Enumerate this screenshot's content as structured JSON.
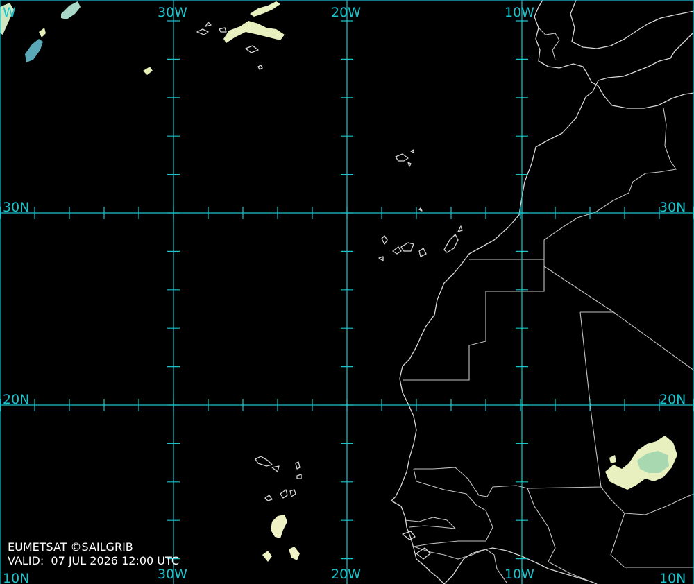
{
  "map": {
    "longitude_labels": [
      "30W",
      "20W",
      "10W"
    ],
    "latitude_labels": [
      "30N",
      "20N",
      "10N"
    ],
    "corner_label_top_left": "W",
    "corner_label_bottom_left": "10N",
    "features": [
      "coastline",
      "country-borders",
      "lat-lon-grid",
      "cloud-imagery"
    ]
  },
  "colors": {
    "background": "#000000",
    "grid": "#19c4cc",
    "coastline": "#d8d8d8",
    "cloud_light": "#e8f0c0",
    "cloud_mid": "#a8d8b0",
    "cloud_cool": "#5aa8b8"
  },
  "footer": {
    "credit": "EUMETSAT ©SAILGRIB",
    "valid_label": "VALID:",
    "valid_time": "07 JUL 2026 12:00 UTC"
  }
}
